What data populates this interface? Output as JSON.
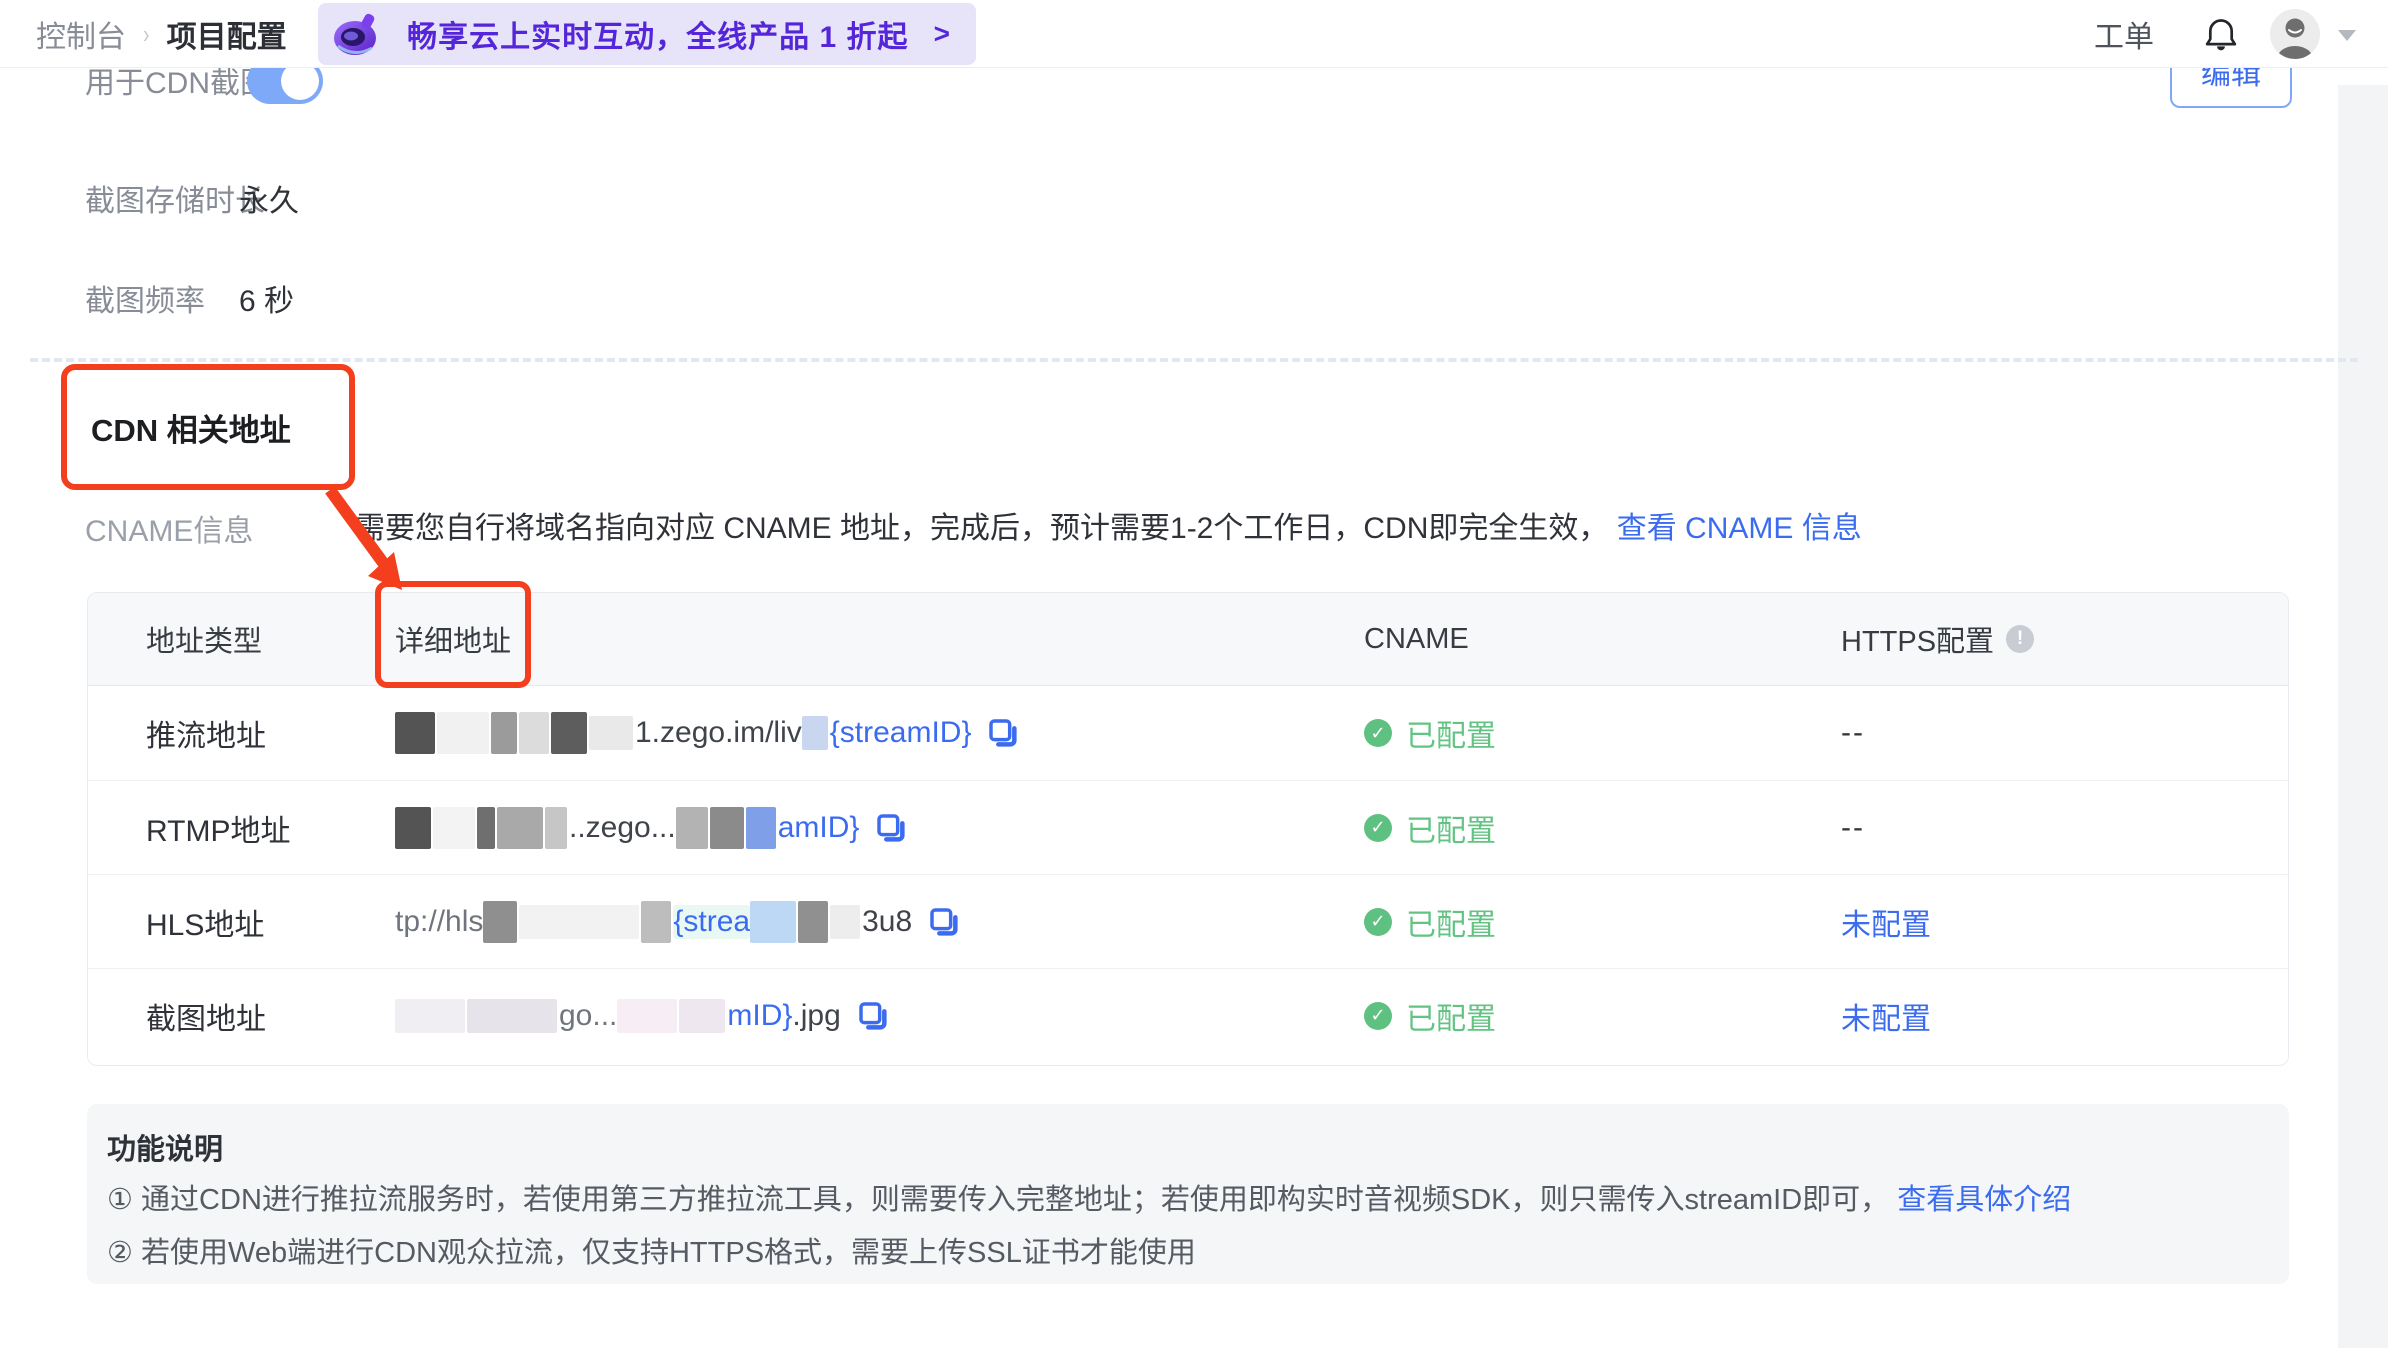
{
  "header": {
    "breadcrumb": {
      "root": "控制台",
      "separator": "›",
      "current": "项目配置"
    },
    "banner": {
      "text": "畅享云上实时互动，全线产品 1 折起",
      "arrow": ">"
    },
    "ticket_label": "工单"
  },
  "edit_button_label": "编辑",
  "settings": {
    "toggle_row_label": "用于CDN截图",
    "toggle_on": true,
    "storage_label": "截图存储时长",
    "storage_value": "永久",
    "frequency_label": "截图频率",
    "frequency_value": "6 秒"
  },
  "section": {
    "title": "CDN 相关地址",
    "cname_label": "CNAME信息",
    "cname_desc": "需要您自行将域名指向对应 CNAME 地址，完成后，预计需要1-2个工作日，CDN即完全生效，",
    "cname_link": "查看 CNAME 信息"
  },
  "table": {
    "columns": [
      "地址类型",
      "详细地址",
      "CNAME",
      "HTTPS配置"
    ],
    "https_info_icon": "!",
    "rows": [
      {
        "type": "推流地址",
        "url_a": "1.zego.im/liv",
        "url_b": "{streamID}",
        "url_c": "",
        "cname_status": "已配置",
        "https": "--"
      },
      {
        "type": "RTMP地址",
        "url_a": "..zego...",
        "url_b": "amID}",
        "url_c": "",
        "cname_status": "已配置",
        "https": "--"
      },
      {
        "type": "HLS地址",
        "url_a": "tp://hls",
        "url_b": "{strea",
        "url_c": "3u8",
        "cname_status": "已配置",
        "https": "未配置"
      },
      {
        "type": "截图地址",
        "url_a": "go...",
        "url_b": "mID}",
        "url_c": ".jpg",
        "cname_status": "已配置",
        "https": "未配置"
      }
    ]
  },
  "notes": {
    "title": "功能说明",
    "line1": "① 通过CDN进行推拉流服务时，若使用第三方推拉流工具，则需要传入完整地址；若使用即构实时音视频SDK，则只需传入streamID即可，",
    "line1_link": "查看具体介绍",
    "line2": "② 若使用Web端进行CDN观众拉流，仅支持HTTPS格式，需要上传SSL证书才能使用"
  },
  "colors": {
    "link_blue": "#3b6cf0",
    "status_green": "#5fc181",
    "annotation_red": "#f43f1e",
    "banner_purple": "#5526d9"
  }
}
